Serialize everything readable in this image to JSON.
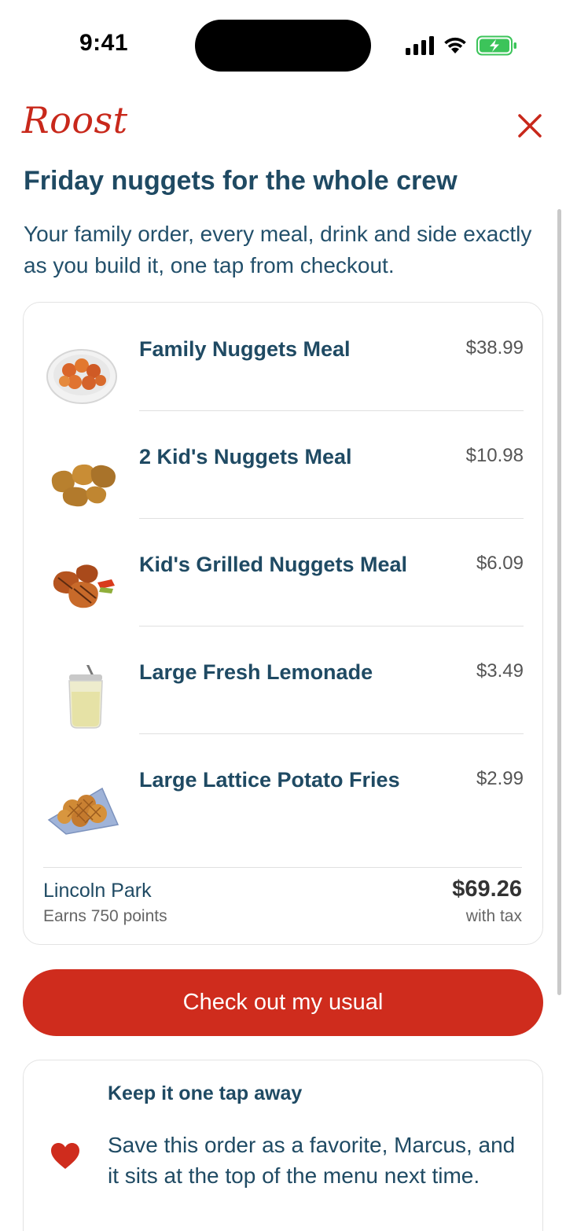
{
  "status_bar": {
    "time": "9:41"
  },
  "header": {
    "brand": "Roost",
    "close_icon": "close-icon"
  },
  "main": {
    "title": "Friday nuggets for the whole crew",
    "subtitle": "Your family order, every meal, drink and side exactly as you build it, one tap from checkout."
  },
  "order": {
    "items": [
      {
        "name": "Family Nuggets Meal",
        "price": "$38.99"
      },
      {
        "name": "2 Kid's Nuggets Meal",
        "price": "$10.98"
      },
      {
        "name": "Kid's Grilled Nuggets Meal",
        "price": "$6.09"
      },
      {
        "name": "Large Fresh Lemonade",
        "price": "$3.49"
      },
      {
        "name": "Large Lattice Potato Fries",
        "price": "$2.99"
      }
    ],
    "store": "Lincoln Park",
    "points": "Earns 750 points",
    "total": "$69.26",
    "tax_note": "with tax"
  },
  "checkout": {
    "label": "Check out my usual"
  },
  "favorite": {
    "title": "Keep it one tap away",
    "body": "Save this order as a favorite, Marcus, and it sits at the top of the menu next time."
  },
  "colors": {
    "accent": "#cf2c1d",
    "text_primary": "#1f4a63",
    "battery": "#3cc45a"
  }
}
